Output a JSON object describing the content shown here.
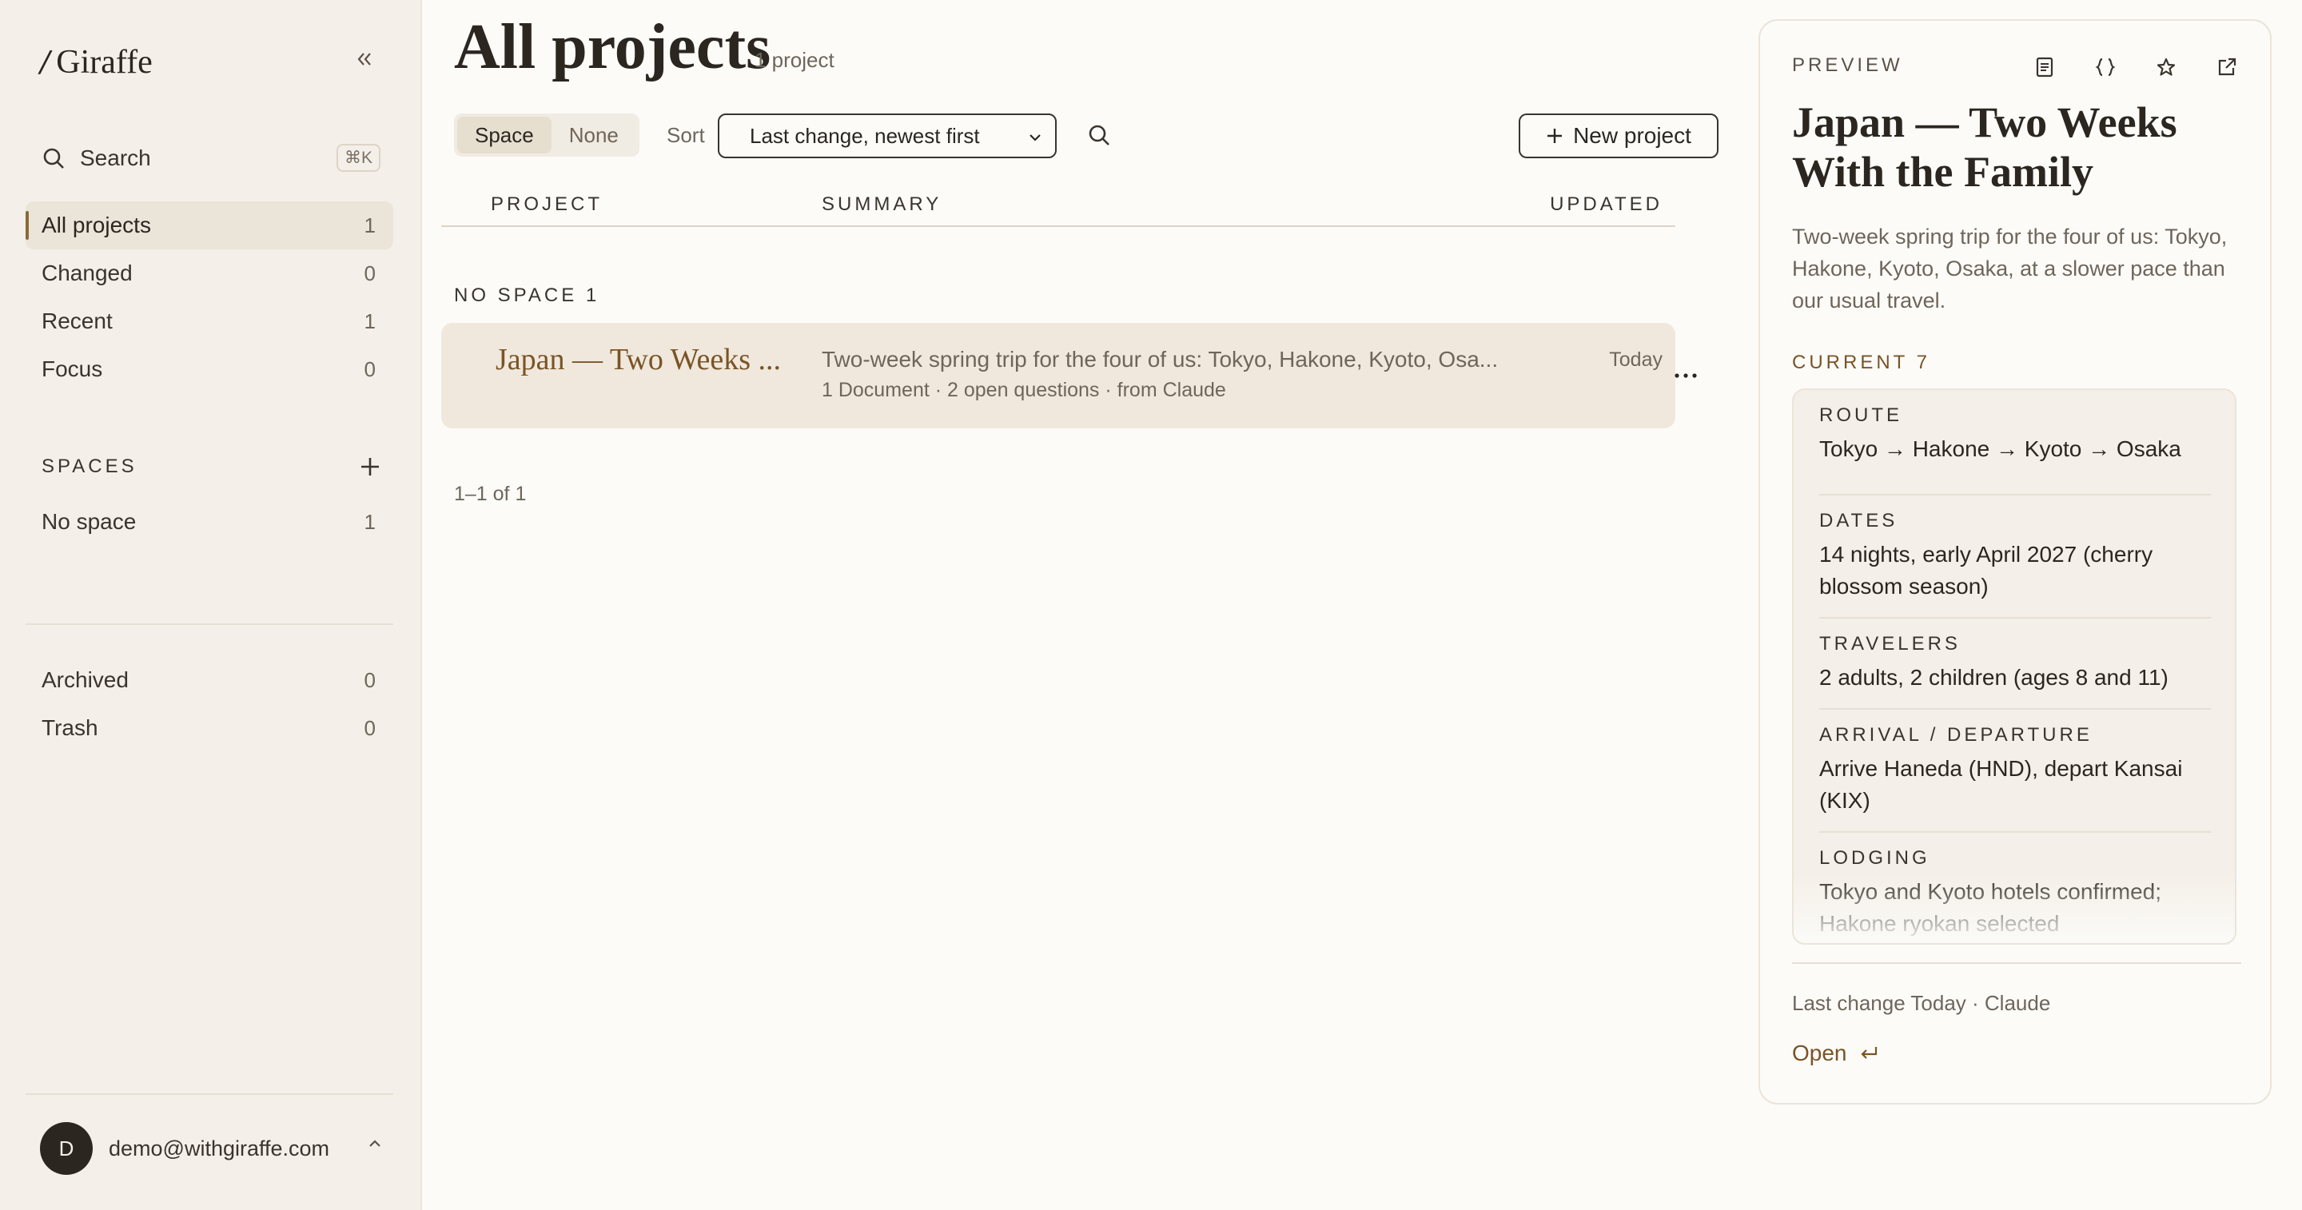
{
  "sidebar": {
    "brand": "Giraffe",
    "search_label": "Search",
    "search_shortcut": "⌘K",
    "nav": [
      {
        "label": "All projects",
        "count": "1"
      },
      {
        "label": "Changed",
        "count": "0"
      },
      {
        "label": "Recent",
        "count": "1"
      },
      {
        "label": "Focus",
        "count": "0"
      }
    ],
    "spaces_title": "SPACES",
    "spaces": [
      {
        "label": "No space",
        "count": "1"
      }
    ],
    "bottom_nav": [
      {
        "label": "Archived",
        "count": "0"
      },
      {
        "label": "Trash",
        "count": "0"
      }
    ],
    "account": {
      "initial": "D",
      "email": "demo@withgiraffe.com"
    }
  },
  "main": {
    "title": "All projects",
    "count_label": "1 project",
    "group_toggle": [
      "Space",
      "None"
    ],
    "sort_label": "Sort",
    "sort_value": "Last change, newest first",
    "new_project_label": "New project",
    "columns": [
      "PROJECT",
      "SUMMARY",
      "UPDATED"
    ],
    "group_title": "NO SPACE 1",
    "rows": [
      {
        "name": "Japan — Two Weeks ...",
        "summary": "Two-week spring trip for the four of us: Tokyo, Hakone, Kyoto, Osa...",
        "meta": "1 Document · 2 open questions · from Claude",
        "updated": "Today"
      }
    ],
    "pager": "1–1 of 1"
  },
  "preview": {
    "label": "PREVIEW",
    "title": "Japan — Two Weeks With the Family",
    "description": "Two-week spring trip for the four of us: Tokyo, Hakone, Kyoto, Osaka, at a slower pace than our usual travel.",
    "current_label": "CURRENT 7",
    "facts": [
      {
        "key": "ROUTE",
        "value": "Tokyo → Hakone → Kyoto → Osaka"
      },
      {
        "key": "DATES",
        "value": "14 nights, early April 2027 (cherry blossom season)"
      },
      {
        "key": "TRAVELERS",
        "value": "2 adults, 2 children (ages 8 and 11)"
      },
      {
        "key": "ARRIVAL / DEPARTURE",
        "value": "Arrive Haneda (HND), depart Kansai (KIX)"
      },
      {
        "key": "LODGING",
        "value": "Tokyo and Kyoto hotels confirmed; Hakone ryokan selected"
      }
    ],
    "last_change": "Last change Today · Claude",
    "open_label": "Open"
  }
}
